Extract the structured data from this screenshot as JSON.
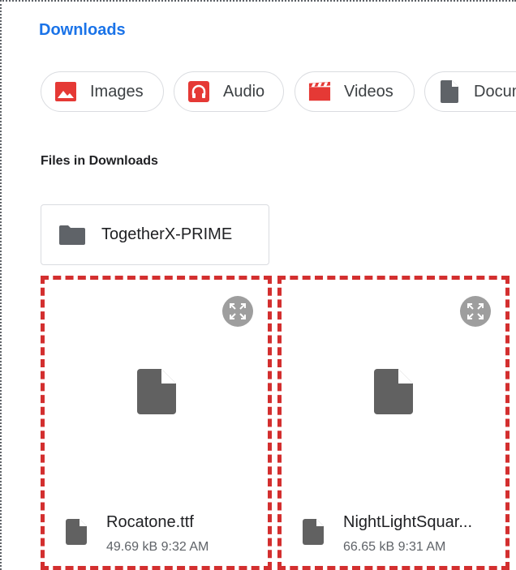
{
  "breadcrumb": {
    "title": "Downloads"
  },
  "chips": [
    {
      "label": "Images",
      "icon": "image-icon",
      "color": "#e53935"
    },
    {
      "label": "Audio",
      "icon": "headphones-icon",
      "color": "#e53935"
    },
    {
      "label": "Videos",
      "icon": "clapperboard-icon",
      "color": "#e53935"
    },
    {
      "label": "Documents",
      "icon": "document-icon",
      "color": "#5f6368"
    }
  ],
  "section": {
    "title": "Files in Downloads"
  },
  "folder": {
    "name": "TogetherX-PRIME",
    "icon": "folder-icon"
  },
  "files": [
    {
      "name": "Rocatone.ttf",
      "size": "49.69 kB",
      "time": "9:32 AM"
    },
    {
      "name": "NightLightSquar...",
      "size": "66.65 kB",
      "time": "9:31 AM"
    }
  ],
  "colors": {
    "accent": "#1a73e8",
    "highlight": "#d32f2f",
    "icon_gray": "#5f6368"
  }
}
